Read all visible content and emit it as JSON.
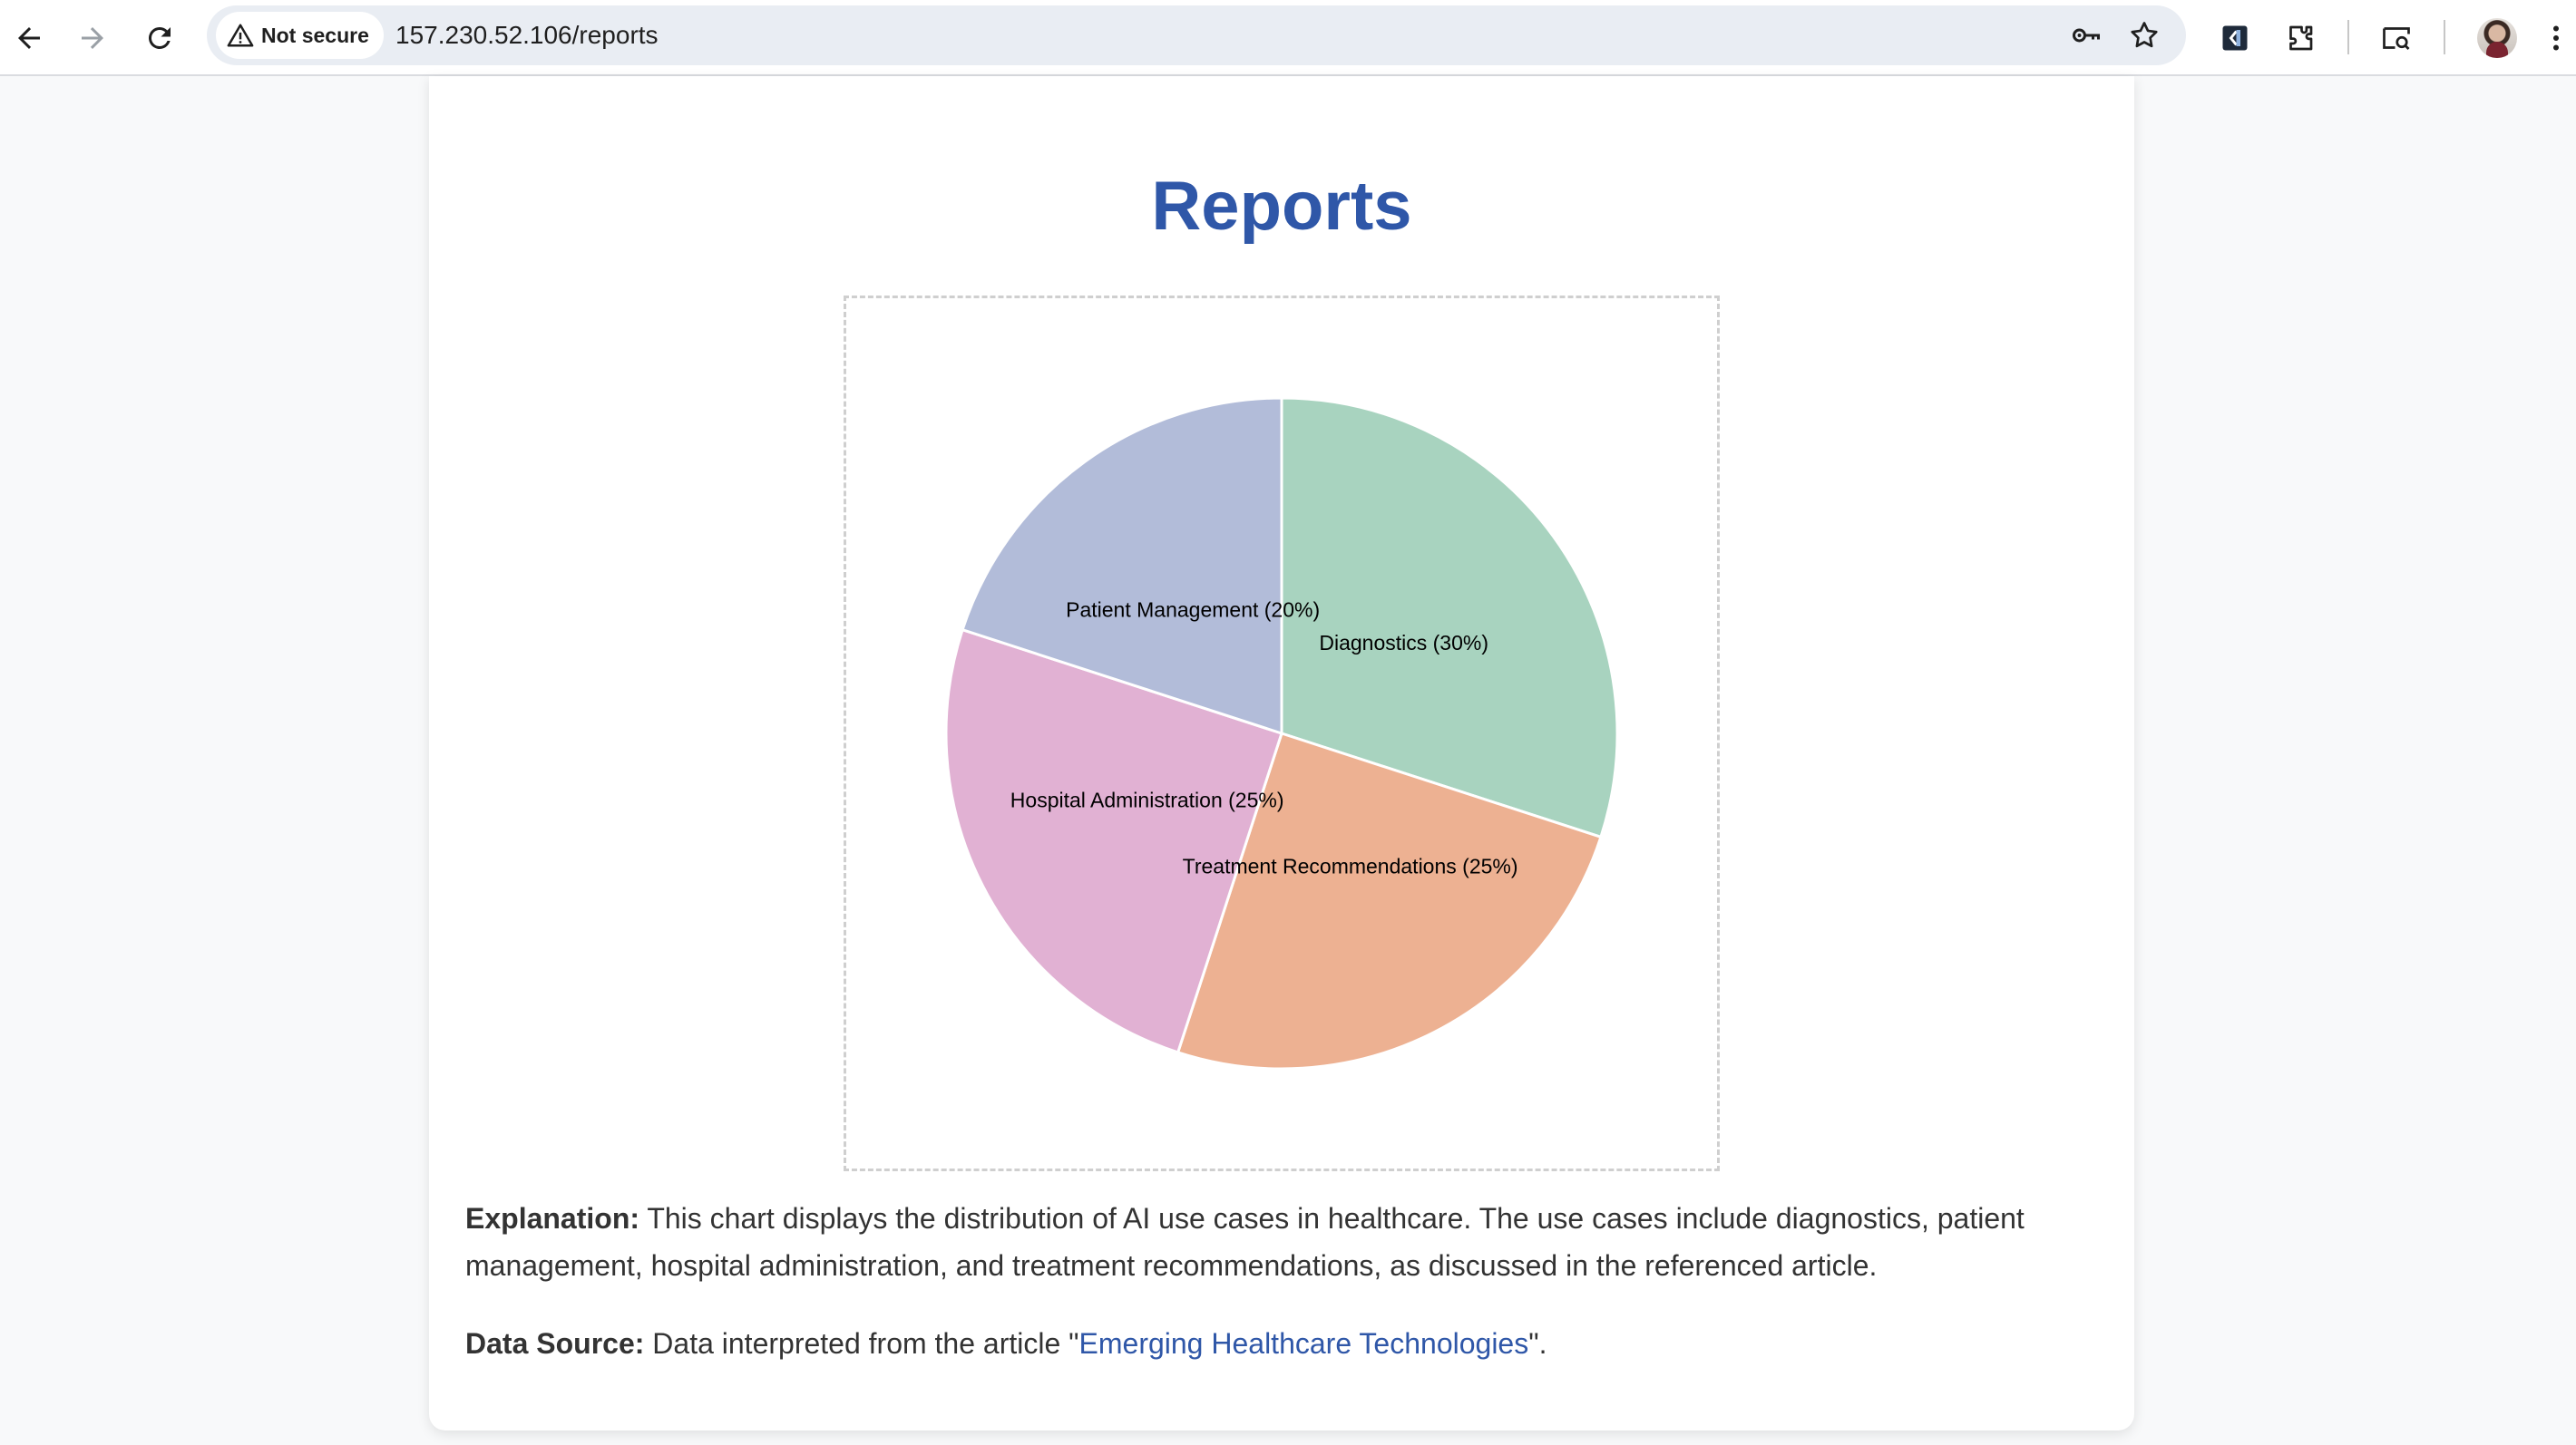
{
  "browser": {
    "security_label": "Not secure",
    "url": "157.230.52.106/reports"
  },
  "page": {
    "title": "Reports",
    "explanation_label": "Explanation:",
    "explanation_text": "This chart displays the distribution of AI use cases in healthcare. The use cases include diagnostics, patient management, hospital administration, and treatment recommendations, as discussed in the referenced article.",
    "source_label": "Data Source:",
    "source_prefix": "Data interpreted from the article \"",
    "source_link": "Emerging Healthcare Technologies",
    "source_suffix": "\"."
  },
  "chart_data": {
    "type": "pie",
    "title": "",
    "categories": [
      "Diagnostics",
      "Treatment Recommendations",
      "Hospital Administration",
      "Patient Management"
    ],
    "values": [
      30,
      25,
      25,
      20
    ],
    "labels": [
      "Diagnostics (30%)",
      "Treatment Recommendations (25%)",
      "Hospital Administration (25%)",
      "Patient Management (20%)"
    ],
    "colors": [
      "#a8d3bf",
      "#edb192",
      "#e1b1d3",
      "#b2bcd9"
    ],
    "start": "12 o'clock",
    "direction": "clockwise",
    "legend": "none"
  }
}
